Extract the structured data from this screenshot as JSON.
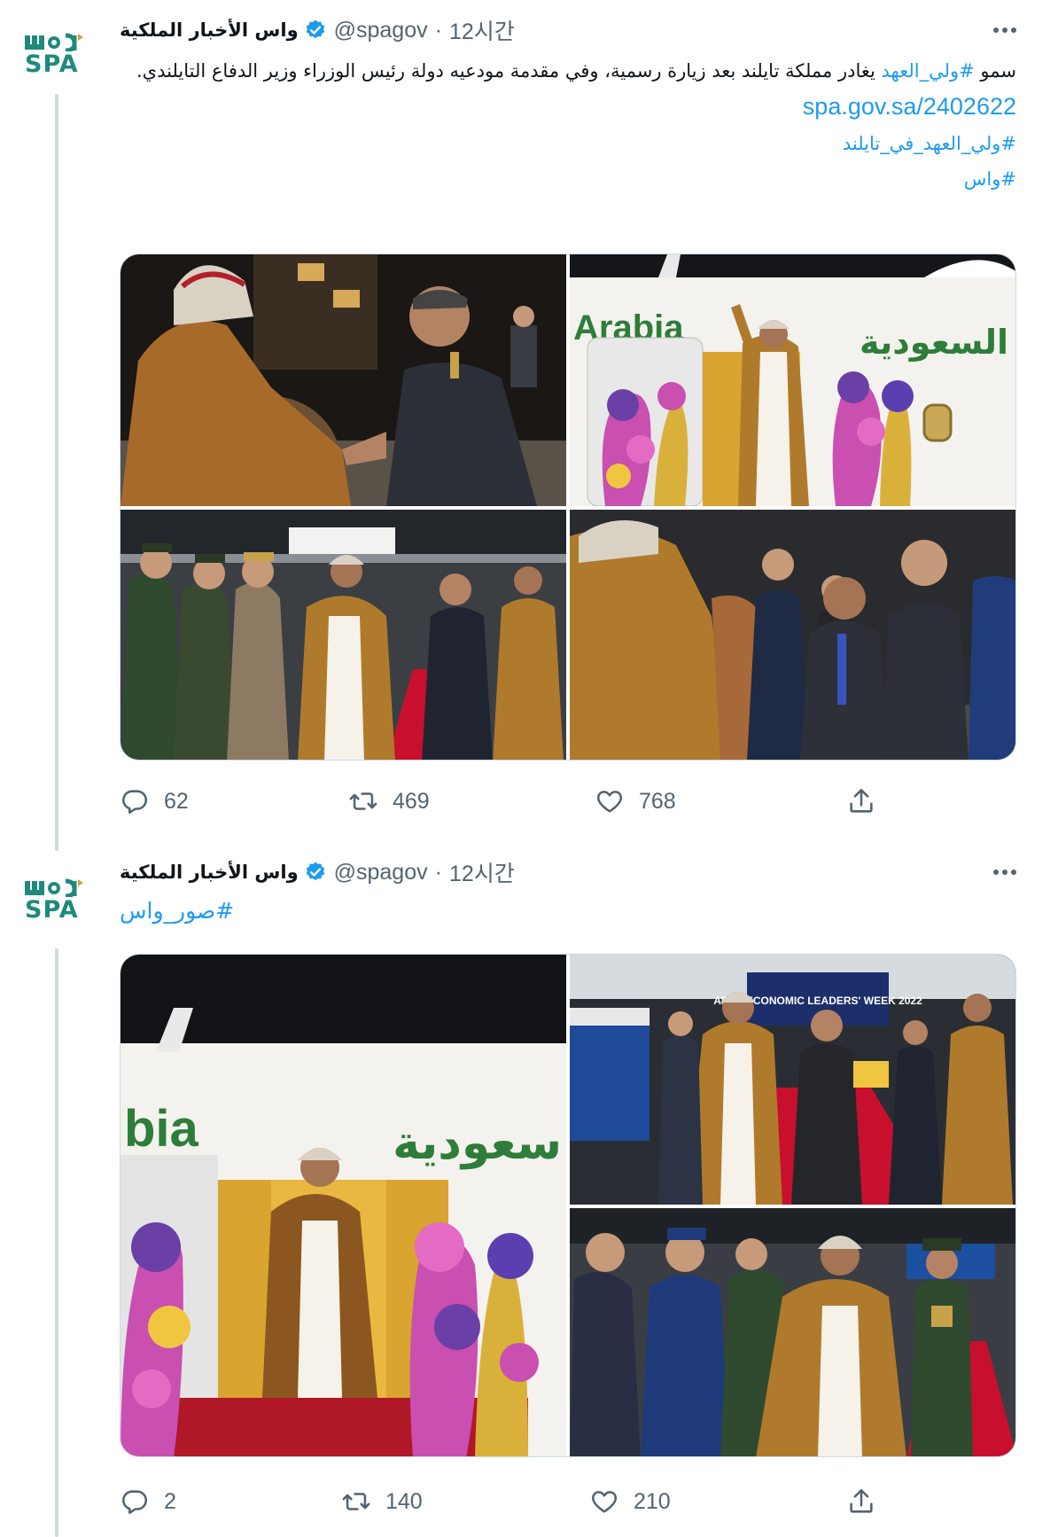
{
  "tweets": [
    {
      "account_name": "واس الأخبار الملكية",
      "handle": "@spagov",
      "separator": "·",
      "time": "12시간",
      "avatar_top_text": "واس",
      "avatar_logo_text": "SPA",
      "text_prefix": "سمو ",
      "hashtag_crown_prince": "#ولي_العهد",
      "text_body": " يغادر مملكة تايلند بعد زيارة رسمية، وفي مقدمة مودعيه دولة رئيس الوزراء وزير الدفاع التايلندي.",
      "link": "spa.gov.sa/2402622",
      "hashtag_thailand": "#ولي_العهد_في_تايلند",
      "hashtag_spa": "#واس",
      "photo_text_arabia": "Arabia",
      "photo_text_saudia": "السعودية",
      "stats": {
        "replies": "62",
        "retweets": "469",
        "likes": "768"
      }
    },
    {
      "account_name": "واس الأخبار الملكية",
      "handle": "@spagov",
      "separator": "·",
      "time": "12시간",
      "avatar_top_text": "واس",
      "avatar_logo_text": "SPA",
      "hashtag_photos": "#صور_واس",
      "photo_text_arabia": "bia",
      "photo_text_saudia": "سعودية",
      "photo_banner_text": "APEC ECONOMIC LEADERS' WEEK 2022",
      "stats": {
        "replies": "2",
        "retweets": "140",
        "likes": "210"
      }
    }
  ],
  "icons": {
    "verified": "verified-badge-icon",
    "more": "more-options-icon",
    "reply": "reply-icon",
    "retweet": "retweet-icon",
    "like": "like-icon",
    "share": "share-icon"
  },
  "colors": {
    "link": "#1d9bf0",
    "muted": "#536471",
    "spa_green": "#1f8a7c",
    "robe_gold": "#b07a2c",
    "carpet_red": "#c8102e"
  }
}
